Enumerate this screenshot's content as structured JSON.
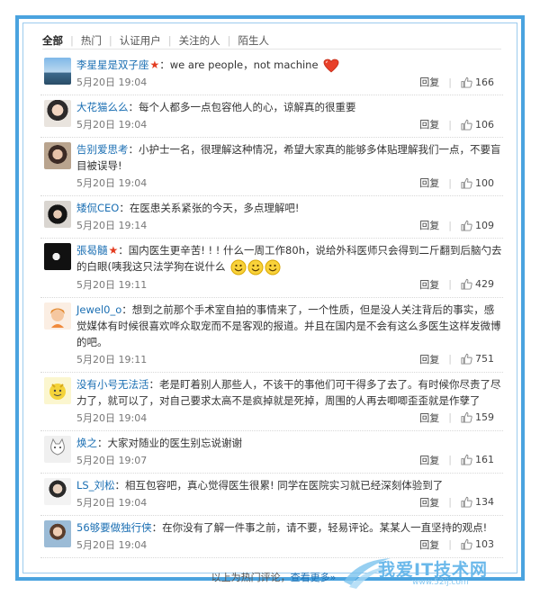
{
  "tabs": [
    {
      "label": "全部",
      "active": true
    },
    {
      "label": "热门"
    },
    {
      "label": "认证用户"
    },
    {
      "label": "关注的人"
    },
    {
      "label": "陌生人"
    }
  ],
  "comments": [
    {
      "user": "李星星是双子座",
      "verified_star": true,
      "text": "we are people，not machine",
      "emoji": "heart-icon",
      "time": "5月20日 19:04",
      "reply": "回复",
      "likes": "166"
    },
    {
      "user": "大花猫么么",
      "verified_star": false,
      "text": "每个人都多一点包容他人的心，谅解真的很重要",
      "time": "5月20日 19:04",
      "reply": "回复",
      "likes": "106"
    },
    {
      "user": "告别爱思考",
      "verified_star": false,
      "text": "小护士一名，很理解这种情况，希望大家真的能够多体贴理解我们一点，不要盲目被误导!",
      "time": "5月20日 19:04",
      "reply": "回复",
      "likes": "100"
    },
    {
      "user": "矮侃CEO",
      "verified_star": false,
      "text": "在医患关系紧张的今天，多点理解吧!",
      "time": "5月20日 19:14",
      "reply": "回复",
      "likes": "109"
    },
    {
      "user": "張曷髓",
      "verified_star": true,
      "text": "国内医生更辛苦! ! ! 什么一周工作80h，说给外科医师只会得到二斤翻到后脑勺去的白眼(咦我这只法学狗在说什么",
      "emoji": "smile-icons",
      "time": "5月20日 19:11",
      "reply": "回复",
      "likes": "429"
    },
    {
      "user": "Jewel0_o",
      "verified_star": false,
      "text": "想到之前那个手术室自拍的事情来了，一个性质，但是没人关注背后的事实，感觉媒体有时候很喜欢哗众取宠而不是客观的报道。并且在国内是不会有这么多医生这样发微博的吧。",
      "time": "5月20日 19:11",
      "reply": "回复",
      "likes": "751"
    },
    {
      "user": "没有小号无法活",
      "verified_star": false,
      "text": "老是盯着别人那些人，不该干的事他们可干得多了去了。有时候你尽责了尽力了，就可以了，对自己要求太高不是疯掉就是死掉，周围的人再去唧唧歪歪就是作孽了",
      "time": "5月20日 19:04",
      "reply": "回复",
      "likes": "159"
    },
    {
      "user": "焕之",
      "verified_star": false,
      "text": "大家对随业的医生别忘说谢谢",
      "time": "5月20日 19:07",
      "reply": "回复",
      "likes": "161"
    },
    {
      "user": "LS_刘松",
      "verified_star": false,
      "text": "相互包容吧，真心觉得医生很累! 同学在医院实习就已经深刻体验到了",
      "time": "5月20日 19:04",
      "reply": "回复",
      "likes": "134"
    },
    {
      "user": "56够要做独行侠",
      "verified_star": false,
      "text": "在你没有了解一件事之前，请不要，轻易评论。某某人一直坚持的观点!",
      "time": "5月20日 19:04",
      "reply": "回复",
      "likes": "103"
    }
  ],
  "footer": {
    "prefix": "以上为热门评论，",
    "more": "查看更多»"
  },
  "watermark": {
    "text": "我爱IT技术网",
    "url": "www.52ij.com"
  },
  "colors": {
    "frame": "#4aa3df",
    "link": "#1b6fb3",
    "star": "#e33b1f"
  }
}
